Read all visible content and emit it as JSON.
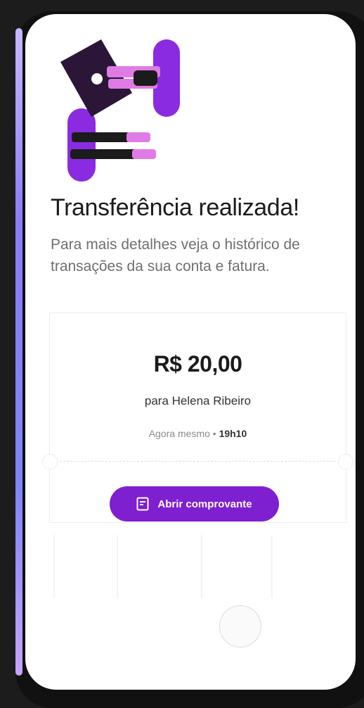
{
  "screen": {
    "title": "Transferência realizada!",
    "subtitle": "Para mais detalhes veja o histórico de transações da sua conta e fatura."
  },
  "receipt_card": {
    "amount": "R$ 20,00",
    "recipient": "para Helena Ribeiro",
    "when": "Agora mesmo",
    "separator": "•",
    "time": "19h10",
    "button_label": "Abrir comprovante"
  },
  "colors": {
    "accent": "#7e1fd0",
    "illustration_purple": "#8a2be2",
    "illustration_pink": "#e07be6",
    "illustration_dark": "#2b1638"
  },
  "icons": {
    "receipt_button": "document-icon",
    "illustration": "transfer-illustration"
  }
}
